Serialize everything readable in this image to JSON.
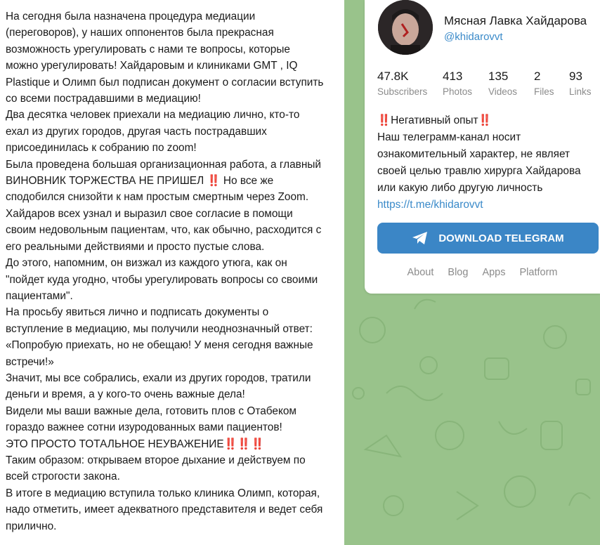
{
  "post": {
    "lines": [
      "На сегодня была назначена процедура медиации",
      "(переговоров), у наших оппонентов была прекрасная",
      "возможность урегулировать с нами те вопросы, которые",
      "можно урегулировать! Хайдаровым и клиниками GMT , IQ",
      "Plastique и Олимп был подписан документ о согласии вступить",
      "со всеми пострадавшими в медиацию!",
      "Два десятка человек приехали на медиацию лично, кто-то",
      "ехал из других городов, другая часть пострадавших",
      "присоединилась к собранию по zoom!",
      "Была проведена большая организационная работа, а главный",
      "ВИНОВНИК ТОРЖЕСТВА НЕ ПРИШЕЛ ‼️ Но все же",
      "сподобился снизойти к нам простым смертным через Zoom.",
      "Хайдаров всех узнал и выразил свое согласие в помощи",
      "своим недовольным пациентам, что, как обычно, расходится с",
      "его реальными действиями и просто пустые слова.",
      "До этого, напомним, он визжал из каждого утюга, как он",
      "\"пойдет куда угодно, чтобы урегулировать вопросы со своими",
      "пациентами\".",
      "На просьбу явиться лично и подписать документы о",
      "вступление в медиацию, мы получили неоднозначный ответ:",
      "«Попробую приехать, но не обещаю! У меня сегодня важные",
      "встречи!»",
      "Значит, мы все собрались, ехали из других городов, тратили",
      "деньги и время, а у кого-то очень важные дела!",
      "Видели мы ваши важные дела, готовить плов с Отабеком",
      "гораздо важнее сотни изуродованных вами пациентов!",
      "ЭТО ПРОСТО ТОТАЛЬНОЕ НЕУВАЖЕНИЕ‼️‼️‼️",
      "Таким образом: открываем второе дыхание и действуем по",
      "всей строгости закона.",
      "В итоге в медиацию вступила только клиника Олимп, которая,",
      "надо отметить, имеет адекватного представителя и ведет себя",
      "прилично."
    ]
  },
  "channel": {
    "name": "Мясная Лавка Хайдарова",
    "handle": "@khidarovvt",
    "stats": [
      {
        "value": "47.8K",
        "label": "Subscribers"
      },
      {
        "value": "413",
        "label": "Photos"
      },
      {
        "value": "135",
        "label": "Videos"
      },
      {
        "value": "2",
        "label": "Files"
      },
      {
        "value": "93",
        "label": "Links"
      }
    ],
    "description": {
      "heading": "‼️Негативный опыт‼️",
      "body": "Наш телеграмм-канал носит ознакомительный характер, не являет своей целью травлю хирурга Хайдарова или какую либо другую личность",
      "link": "https://t.me/khidarovvt"
    },
    "download_label": "DOWNLOAD TELEGRAM",
    "footer": [
      "About",
      "Blog",
      "Apps",
      "Platform"
    ]
  },
  "colors": {
    "accent": "#3b86c6",
    "link": "#3a8ac9",
    "background_pattern": "#99c38b"
  }
}
